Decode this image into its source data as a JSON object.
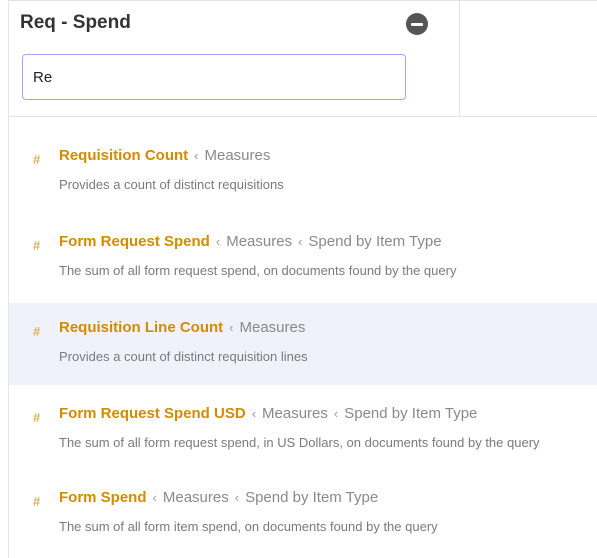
{
  "header": {
    "title": "Req - Spend"
  },
  "search": {
    "value": "Re"
  },
  "results": [
    {
      "name": "Requisition Count",
      "path": [
        "Measures"
      ],
      "description": "Provides a count of distinct requisitions",
      "highlighted": false
    },
    {
      "name": "Form Request Spend",
      "path": [
        "Measures",
        "Spend by Item Type"
      ],
      "description": "The sum of all form request spend, on documents found by the query",
      "highlighted": false
    },
    {
      "name": "Requisition Line Count",
      "path": [
        "Measures"
      ],
      "description": "Provides a count of distinct requisition lines",
      "highlighted": true
    },
    {
      "name": "Form Request Spend USD",
      "path": [
        "Measures",
        "Spend by Item Type"
      ],
      "description": "The sum of all form request spend, in US Dollars, on documents found by the query",
      "highlighted": false
    },
    {
      "name": "Form Spend",
      "path": [
        "Measures",
        "Spend by Item Type"
      ],
      "description": "The sum of all form item spend, on documents found by the query",
      "highlighted": false
    }
  ],
  "colors": {
    "accent": "#d38b00",
    "highlight": "#f0f1fb",
    "input_border": "#a8a3f7"
  }
}
